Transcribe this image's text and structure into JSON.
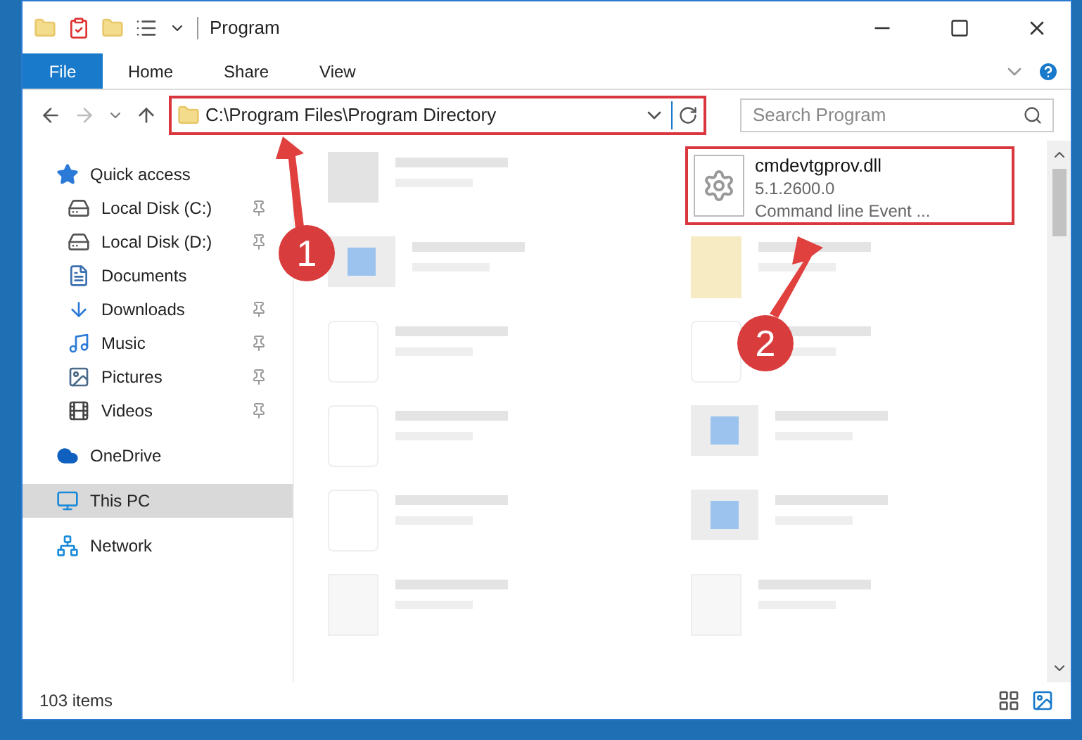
{
  "window": {
    "title": "Program"
  },
  "ribbon": {
    "tabs": [
      {
        "label": "File",
        "selected": true
      },
      {
        "label": "Home",
        "selected": false
      },
      {
        "label": "Share",
        "selected": false
      },
      {
        "label": "View",
        "selected": false
      }
    ]
  },
  "address_bar": {
    "path": "C:\\Program Files\\Program Directory",
    "highlighted": true
  },
  "search": {
    "placeholder": "Search Program"
  },
  "sidebar": {
    "items": [
      {
        "label": "Quick access",
        "kind": "star",
        "selected": false,
        "children": [
          {
            "label": "Local Disk (C:)",
            "kind": "disk",
            "pinned": true,
            "selected": false
          },
          {
            "label": "Local Disk (D:)",
            "kind": "disk",
            "pinned": true,
            "selected": false
          },
          {
            "label": "Documents",
            "kind": "document",
            "pinned": false,
            "selected": false
          },
          {
            "label": "Downloads",
            "kind": "download",
            "pinned": true,
            "selected": false
          },
          {
            "label": "Music",
            "kind": "music",
            "pinned": true,
            "selected": false
          },
          {
            "label": "Pictures",
            "kind": "picture",
            "pinned": true,
            "selected": false
          },
          {
            "label": "Videos",
            "kind": "video",
            "pinned": true,
            "selected": false
          }
        ]
      },
      {
        "label": "OneDrive",
        "kind": "cloud",
        "selected": false
      },
      {
        "label": "This PC",
        "kind": "pc",
        "selected": true
      },
      {
        "label": "Network",
        "kind": "network",
        "selected": false
      }
    ]
  },
  "files": [
    {
      "kind": "blurred-app"
    },
    {
      "kind": "dll",
      "name": "cmdevtgprov.dll",
      "details": [
        "5.1.2600.0",
        "Command line Event ..."
      ],
      "highlighted": true
    },
    {
      "kind": "blurred-window"
    },
    {
      "kind": "blurred-folder"
    },
    {
      "kind": "blurred-file"
    },
    {
      "kind": "blurred-file"
    },
    {
      "kind": "blurred-file"
    },
    {
      "kind": "blurred-window"
    },
    {
      "kind": "blurred-file"
    },
    {
      "kind": "blurred-window"
    },
    {
      "kind": "blurred-dll"
    },
    {
      "kind": "blurred-dll"
    }
  ],
  "status_bar": {
    "text": "103 items"
  },
  "annotations": [
    {
      "label": "1"
    },
    {
      "label": "2"
    }
  ]
}
